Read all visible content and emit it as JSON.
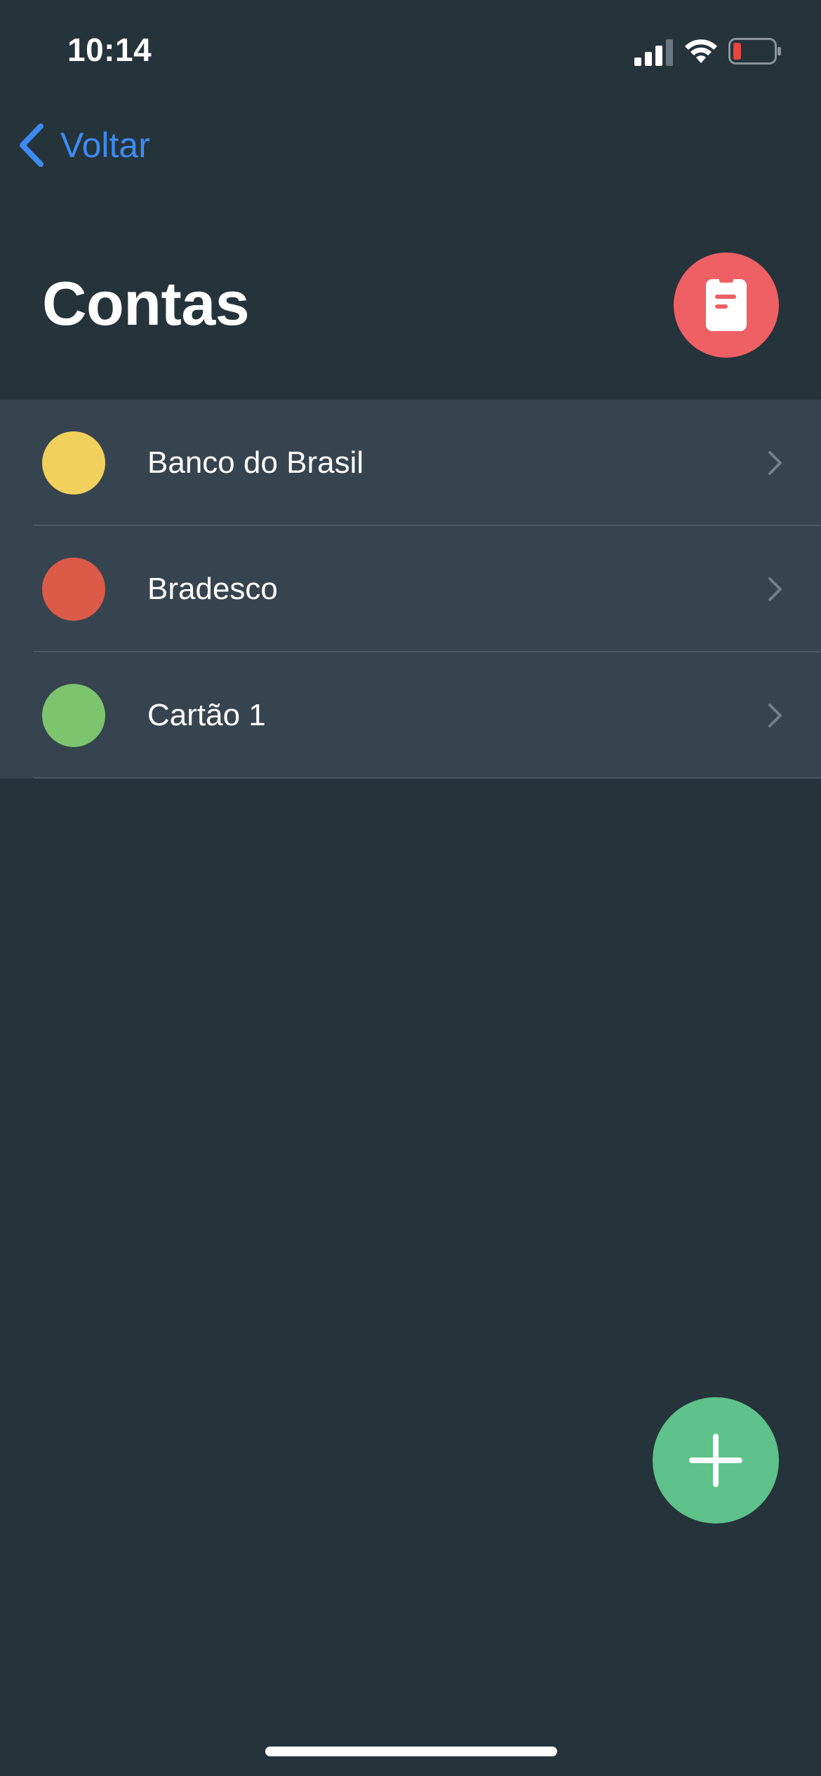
{
  "status_bar": {
    "time": "10:14"
  },
  "nav": {
    "back_label": "Voltar"
  },
  "header": {
    "title": "Contas"
  },
  "accounts": [
    {
      "name": "Banco do Brasil",
      "color": "#f1d05c"
    },
    {
      "name": "Bradesco",
      "color": "#dc5a48"
    },
    {
      "name": "Cartão 1",
      "color": "#7cc46e"
    }
  ],
  "colors": {
    "background": "#25333b",
    "list_background": "#36444f",
    "accent_blue": "#3d8bf2",
    "report_button": "#ee6063",
    "add_button": "#5ec28a",
    "battery_low": "#e8453c"
  },
  "icons": {
    "report_button": "clipboard-icon",
    "add_button": "plus-icon",
    "back": "chevron-left-icon",
    "row": "chevron-right-icon"
  }
}
